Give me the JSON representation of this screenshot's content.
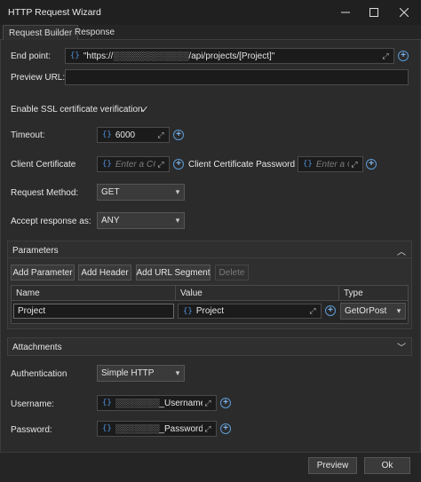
{
  "window": {
    "title": "HTTP Request Wizard"
  },
  "tabs": [
    {
      "label": "Request Builder"
    },
    {
      "label": "Response"
    }
  ],
  "endpoint": {
    "label": "End point:",
    "value": "\"https://░░░░░░░░░░░░/api/projects/[Project]\""
  },
  "preview_url": {
    "label": "Preview URL:",
    "value": ""
  },
  "ssl": {
    "label": "Enable SSL certificate verification",
    "checked": true
  },
  "timeout": {
    "label": "Timeout:",
    "value": "6000"
  },
  "client_cert": {
    "label": "Client Certificate",
    "placeholder": "Enter a C#",
    "password_label": "Client Certificate Password",
    "password_placeholder": "Enter a C#"
  },
  "method": {
    "label": "Request Method:",
    "value": "GET"
  },
  "accept": {
    "label": "Accept response as:",
    "value": "ANY"
  },
  "parameters": {
    "title": "Parameters",
    "buttons": [
      "Add Parameter",
      "Add Header",
      "Add URL Segment",
      "Delete"
    ],
    "columns": [
      "Name",
      "Value",
      "Type"
    ],
    "rows": [
      {
        "name": "Project",
        "value": "Project",
        "type": "GetOrPost"
      }
    ]
  },
  "attachments": {
    "title": "Attachments"
  },
  "auth": {
    "label": "Authentication",
    "value": "Simple HTTP"
  },
  "username": {
    "label": "Username:",
    "value": "░░░░░░░_Username"
  },
  "password": {
    "label": "Password:",
    "value": "░░░░░░░_Password"
  },
  "footer": {
    "preview": "Preview",
    "ok": "Ok"
  },
  "colors": {
    "accent": "#4f8ed8",
    "background": "#2b2b2b"
  }
}
